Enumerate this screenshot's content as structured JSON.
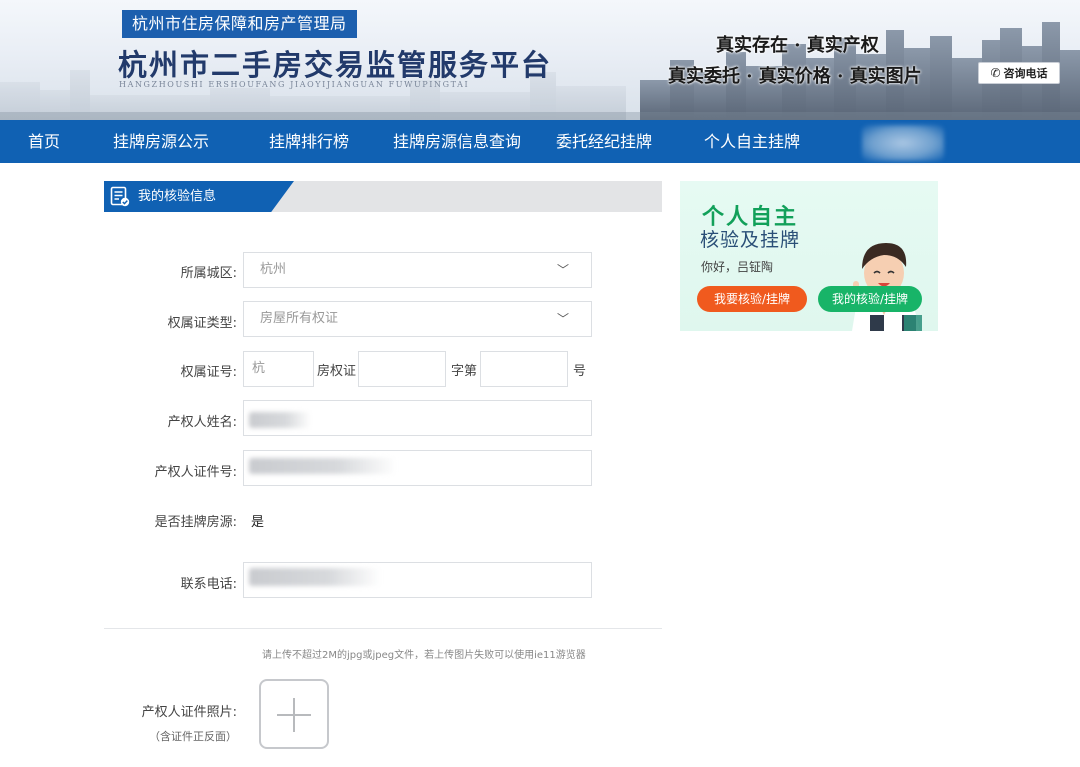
{
  "header": {
    "department": "杭州市住房保障和房产管理局",
    "title": "杭州市二手房交易监管服务平台",
    "pinyin": "HANGZHOUSHI  ERSHOUFANG  JIAOYIJIANGUAN  FUWUPINGTAI",
    "slogan_line1": "真实存在 · 真实产权",
    "slogan_line2": "真实委托 · 真实价格 · 真实图片",
    "consult_label": "咨询电话"
  },
  "nav": {
    "items": [
      "首页",
      "挂牌房源公示",
      "挂牌排行榜",
      "挂牌房源信息查询",
      "委托经纪挂牌",
      "个人自主挂牌"
    ]
  },
  "section": {
    "title": "我的核验信息"
  },
  "form": {
    "district": {
      "label": "所属城区:",
      "value": "杭州"
    },
    "cert_type": {
      "label": "权属证类型:",
      "value": "房屋所有权证"
    },
    "cert_no": {
      "label": "权属证号:",
      "prefix_placeholder": "杭",
      "text1": "房权证",
      "text2": "字第",
      "text3": "号"
    },
    "owner_name": {
      "label": "产权人姓名:"
    },
    "owner_id": {
      "label": "产权人证件号:"
    },
    "is_listed": {
      "label": "是否挂牌房源:",
      "value": "是"
    },
    "phone": {
      "label": "联系电话:"
    },
    "upload_note": "请上传不超过2M的jpg或jpeg文件，若上传图片失败可以使用ie11游览器",
    "photo": {
      "label": "产权人证件照片:",
      "sublabel": "（含证件正反面）"
    }
  },
  "promo": {
    "title1": "个人自主",
    "title2": "核验及挂牌",
    "greeting": "你好，吕钲陶",
    "btn_verify": "我要核验/挂牌",
    "btn_mine": "我的核验/挂牌"
  },
  "colors": {
    "brand_blue": "#1061b3",
    "orange": "#f05a1e",
    "green": "#18b468"
  }
}
